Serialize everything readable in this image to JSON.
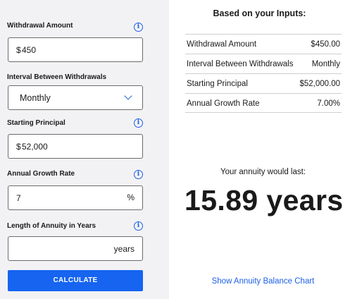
{
  "form": {
    "withdrawal": {
      "label": "Withdrawal Amount",
      "prefix": "$",
      "value": "450"
    },
    "interval": {
      "label": "Interval Between Withdrawals",
      "selected": "Monthly"
    },
    "principal": {
      "label": "Starting Principal",
      "prefix": "$",
      "value": "52,000"
    },
    "growth": {
      "label": "Annual Growth Rate",
      "value": "7",
      "suffix": "%"
    },
    "length": {
      "label": "Length of Annuity in Years",
      "value": "",
      "suffix": "years"
    },
    "calculate_label": "CALCULATE",
    "info_glyph": "i"
  },
  "summary": {
    "title": "Based on your Inputs:",
    "rows": [
      {
        "label": "Withdrawal Amount",
        "value": "$450.00"
      },
      {
        "label": "Interval Between Withdrawals",
        "value": "Monthly"
      },
      {
        "label": "Starting Principal",
        "value": "$52,000.00"
      },
      {
        "label": "Annual Growth Rate",
        "value": "7.00%"
      }
    ]
  },
  "result": {
    "label": "Your annuity would last:",
    "value": "15.89 years"
  },
  "chart_link": "Show Annuity Balance Chart",
  "colors": {
    "accent": "#1664f0",
    "panel": "#f2f2f4"
  },
  "icons": {
    "info": "info-circle-icon",
    "dropdown": "chevron-down-icon"
  }
}
